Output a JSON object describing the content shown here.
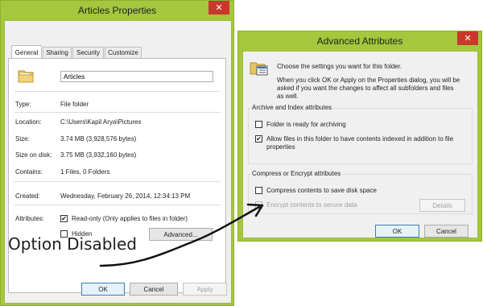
{
  "properties_dialog": {
    "title": "Articles Properties",
    "close_glyph": "✕",
    "tabs": [
      "General",
      "Sharing",
      "Security",
      "Customize"
    ],
    "name_value": "Articles",
    "rows": {
      "type_label": "Type:",
      "type_value": "File folder",
      "location_label": "Location:",
      "location_value": "C:\\Users\\Kapil Arya\\Pictures",
      "size_label": "Size:",
      "size_value": "3.74 MB (3,928,576 bytes)",
      "size_on_disk_label": "Size on disk:",
      "size_on_disk_value": "3.75 MB (3,932,160 bytes)",
      "contains_label": "Contains:",
      "contains_value": "1 Files, 0 Folders",
      "created_label": "Created:",
      "created_value": "Wednesday, February 26, 2014, 12:34:13 PM",
      "attributes_label": "Attributes:"
    },
    "readonly_label": "Read-only (Only applies to files in folder)",
    "hidden_label": "Hidden",
    "advanced_button": "Advanced...",
    "ok_button": "OK",
    "cancel_button": "Cancel",
    "apply_button": "Apply"
  },
  "advanced_dialog": {
    "title": "Advanced Attributes",
    "close_glyph": "✕",
    "intro_line1": "Choose the settings you want for this folder.",
    "intro_line2": "When you click OK or Apply on the Properties dialog, you will be",
    "intro_line3": "asked if you want the changes to affect all subfolders and files",
    "intro_line4": "as well.",
    "archive_group_title": "Archive and Index attributes",
    "archive_label": "Folder is ready for archiving",
    "index_label_line1": "Allow files in this folder to have contents indexed in addition to file",
    "index_label_line2": "properties",
    "compress_group_title": "Compress or Encrypt attributes",
    "compress_label": "Compress contents to save disk space",
    "encrypt_label": "Encrypt contents to secure data",
    "details_button": "Details",
    "ok_button": "OK",
    "cancel_button": "Cancel"
  },
  "annotation": {
    "text": "Option Disabled"
  },
  "checkbox_states": {
    "readonly": true,
    "hidden": false,
    "archive": false,
    "index": true,
    "compress": false,
    "encrypt": false
  },
  "colors": {
    "title_bar": "#a4c73e",
    "close_button": "#c7392b",
    "client_bg": "#f0f0f0",
    "primary_border": "#3c7fb1"
  }
}
